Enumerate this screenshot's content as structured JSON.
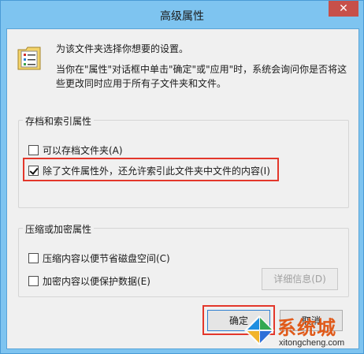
{
  "window": {
    "title": "高级属性",
    "close_label": "✕"
  },
  "intro": {
    "line1": "为该文件夹选择你想要的设置。",
    "line2": "当你在\"属性\"对话框中单击\"确定\"或\"应用\"时，系统会询问你是否将这些更改同时应用于所有子文件夹和文件。"
  },
  "archive_group": {
    "label": "存档和索引属性",
    "options": [
      {
        "label": "可以存档文件夹(A)",
        "checked": false
      },
      {
        "label": "除了文件属性外，还允许索引此文件夹中文件的内容(I)",
        "checked": true
      }
    ]
  },
  "compress_group": {
    "label": "压缩或加密属性",
    "options": [
      {
        "label": "压缩内容以便节省磁盘空间(C)",
        "checked": false
      },
      {
        "label": "加密内容以便保护数据(E)",
        "checked": false
      }
    ],
    "details_button": "详细信息(D)"
  },
  "buttons": {
    "ok": "确定",
    "cancel": "取消"
  },
  "watermark": {
    "main": "系统城",
    "sub": "xitongcheng.com"
  },
  "colors": {
    "titlebar": "#7ec4f0",
    "close": "#c7504a",
    "highlight": "#e3372b",
    "watermark": "#e05a1a"
  }
}
